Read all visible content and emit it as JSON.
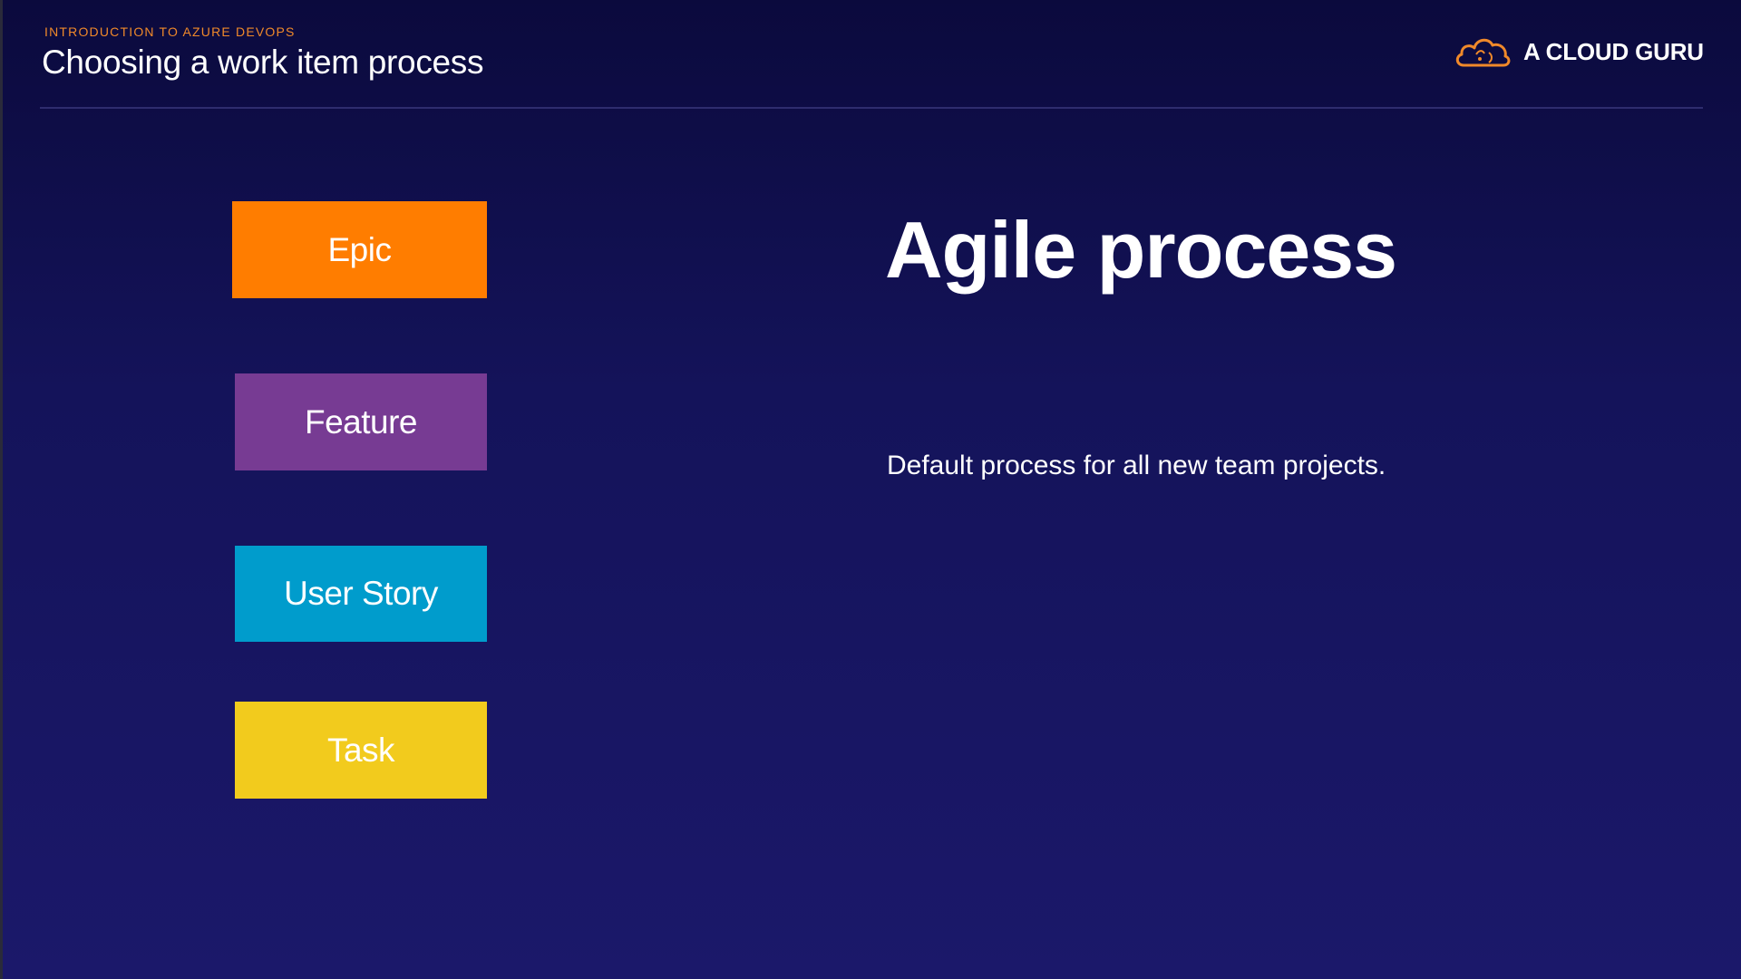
{
  "slide": {
    "course_label": "INTRODUCTION TO AZURE DEVOPS",
    "title": "Choosing a work item process"
  },
  "brand": {
    "name": "A CLOUD GURU",
    "logo_icon": "cloud-icon",
    "logo_color": "#f0892a"
  },
  "work_items": [
    {
      "label": "Epic",
      "color": "#ff7d00"
    },
    {
      "label": "Feature",
      "color": "#773b93"
    },
    {
      "label": "User Story",
      "color": "#009ccc"
    },
    {
      "label": "Task",
      "color": "#f2cb1d"
    }
  ],
  "main": {
    "headline": "Agile process",
    "description": "Default process for all new team projects."
  }
}
